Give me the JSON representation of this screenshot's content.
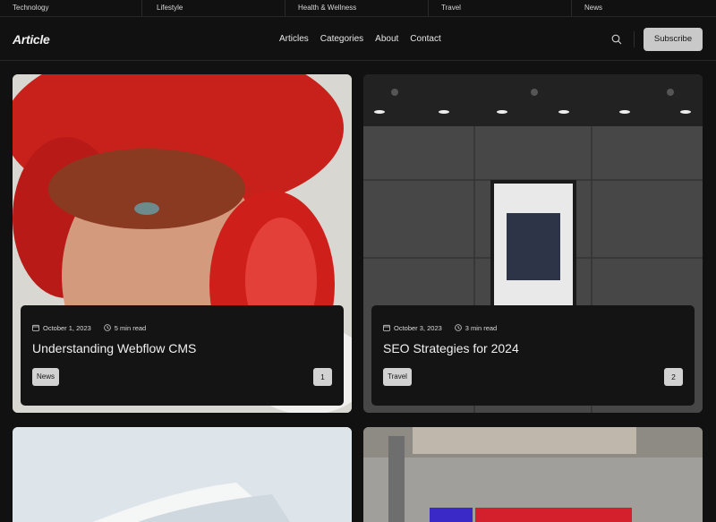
{
  "categories": [
    "Technology",
    "Lifestyle",
    "Health & Wellness",
    "Travel",
    "News"
  ],
  "header": {
    "logo": "Article",
    "nav": [
      "Articles",
      "Categories",
      "About",
      "Contact"
    ],
    "search_icon": "search-icon",
    "subscribe_label": "Subscribe"
  },
  "theme": {
    "background": "#111111",
    "button": "#c9c9c9",
    "card_panel": "#141414"
  },
  "articles": [
    {
      "image": "portrait of freckled person wearing red headphones and red furry hat",
      "date": "October 1, 2023",
      "read_time": "5 min read",
      "title": "Understanding Webflow CMS",
      "tag": "News",
      "index": "1"
    },
    {
      "image": "grey tiled wall with illuminated poster display",
      "date": "October 3, 2023",
      "read_time": "3 min read",
      "title": "SEO Strategies for 2024",
      "tag": "Travel",
      "index": "2"
    },
    {
      "image": "open white book against pale blue background"
    },
    {
      "image": "concrete building facade with red and blue signage"
    }
  ]
}
